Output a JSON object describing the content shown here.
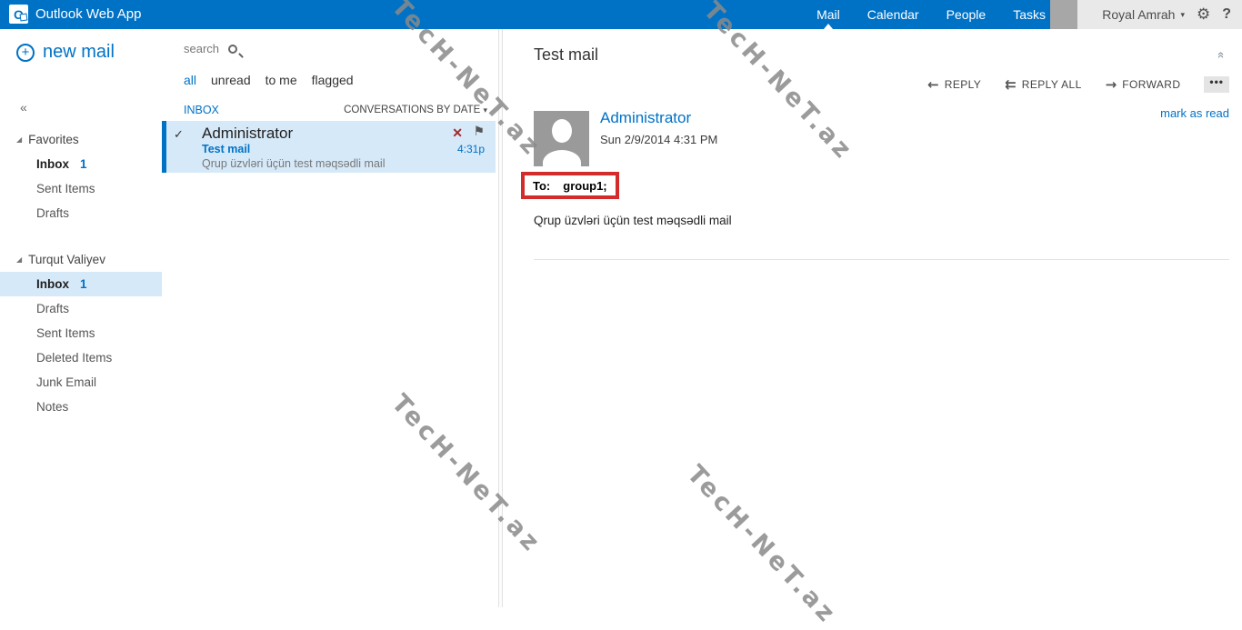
{
  "topbar": {
    "brand": "Outlook Web App",
    "logo_letter": "O",
    "nav": [
      {
        "label": "Mail",
        "active": true
      },
      {
        "label": "Calendar",
        "active": false
      },
      {
        "label": "People",
        "active": false
      },
      {
        "label": "Tasks",
        "active": false
      }
    ],
    "user": "Royal Amrah",
    "user_caret": "▾",
    "gear_icon": "⚙",
    "help_label": "?"
  },
  "sidebar": {
    "new_mail_label": "new mail",
    "plus_glyph": "+",
    "collapse_glyph": "«",
    "tree_glyph": "◢",
    "sections": [
      {
        "title": "Favorites",
        "items": [
          {
            "label": "Inbox",
            "count": "1"
          },
          {
            "label": "Sent Items",
            "count": ""
          },
          {
            "label": "Drafts",
            "count": ""
          }
        ]
      },
      {
        "title": "Turqut Valiyev",
        "items": [
          {
            "label": "Inbox",
            "count": "1"
          },
          {
            "label": "Drafts",
            "count": ""
          },
          {
            "label": "Sent Items",
            "count": ""
          },
          {
            "label": "Deleted Items",
            "count": ""
          },
          {
            "label": "Junk Email",
            "count": ""
          },
          {
            "label": "Notes",
            "count": ""
          }
        ]
      }
    ]
  },
  "list": {
    "search_label": "search",
    "filters": [
      "all",
      "unread",
      "to me",
      "flagged"
    ],
    "active_filter": "all",
    "folder_header": "INBOX",
    "sort_label": "CONVERSATIONS BY DATE",
    "sort_caret": "▾",
    "item": {
      "check_glyph": "✓",
      "sender": "Administrator",
      "subject": "Test mail",
      "preview": "Qrup üzvləri üçün test məqsədli mail",
      "time": "4:31p",
      "delete_glyph": "✕",
      "flag_glyph": "⚑"
    }
  },
  "reading": {
    "subject": "Test mail",
    "collapse_glyph": "«",
    "toolbar": {
      "reply_arrow": "←",
      "reply_label": "REPLY",
      "reply_all_arrow": "⇇",
      "reply_all_label": "REPLY ALL",
      "forward_arrow": "→",
      "forward_label": "FORWARD",
      "more_label": "•••"
    },
    "mark_as_read": "mark as read",
    "sender": "Administrator",
    "date": "Sun 2/9/2014 4:31 PM",
    "to_label": "To:",
    "to_value": "group1;",
    "body": "Qrup üzvləri üçün test məqsədli mail"
  },
  "watermark": {
    "text": "TecH-NeT.az"
  },
  "colors": {
    "accent": "#0072c6",
    "annotation_red": "#d22c2c",
    "selected_bg": "#d6e9f8"
  }
}
